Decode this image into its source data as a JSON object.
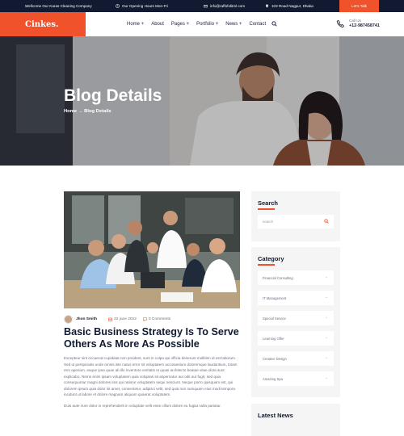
{
  "topbar": {
    "welcome": "Wellcome Our Karas Cleaning Company",
    "hours": "Our Opening Hours Mon-Fri",
    "email": "info@raffofolitml.com",
    "address": "103 Road Nagpur, Dhaka",
    "cta": "Let's Talk"
  },
  "header": {
    "logo": "Cinkes.",
    "nav": [
      "Home +",
      "About",
      "Pages +",
      "Portfolio +",
      "News +",
      "Contact"
    ],
    "call_label": "Call Us",
    "call_number": "+12-987458741"
  },
  "hero": {
    "title": "Blog Details",
    "breadcrumb_home": "Home",
    "breadcrumb_sep": "→",
    "breadcrumb_current": "Blog Details"
  },
  "post": {
    "author": "Jhon Smith",
    "date": "22 june 2022",
    "comments": "0 Comments",
    "title": "Basic Business Strategy Is To Serve Others As More As Possible",
    "body": "Excepteur sint occaecat cupidatat non proident, sunt in culpa qui officia deserunt mollitinn id est laborum. Sed ut perspiciatis unde omnis iste natus error sit voluptatem accusantium doloremque laudantium, totam rem aperiam, eaque ipsa quae ab illo inventore veritatis et quasi architecto beatae vitae dicta sunt explicabo. Nemo enim ipsam voluptatem quia voluptas sit aspernatur aut odit aut fugit, sed quia consequuntur magni dolores eos qui ratione voluptatem sequi nesciunt. Neque porro quisquam est, qui dolorem ipsum quia dolor sit amet, consectetur, adipisci velit, sed quia non numquam eius modi tempora incidunt ut labore et dolore magnam aliquam quaerat voluptatem.",
    "body2": "Duis aute irure dolor in reprehenderit in voluptate velit esse cillum dolore eu fugiat nulla pariatur."
  },
  "sidebar": {
    "search_title": "Search",
    "search_placeholder": "search",
    "category_title": "Category",
    "categories": [
      "Financial Consulting",
      "IT Management",
      "Special Service",
      "Learning Offer",
      "Creative Design",
      "Amazing Spa"
    ],
    "news_title": "Latest News"
  },
  "colors": {
    "accent": "#f0522b",
    "dark": "#111a31"
  }
}
